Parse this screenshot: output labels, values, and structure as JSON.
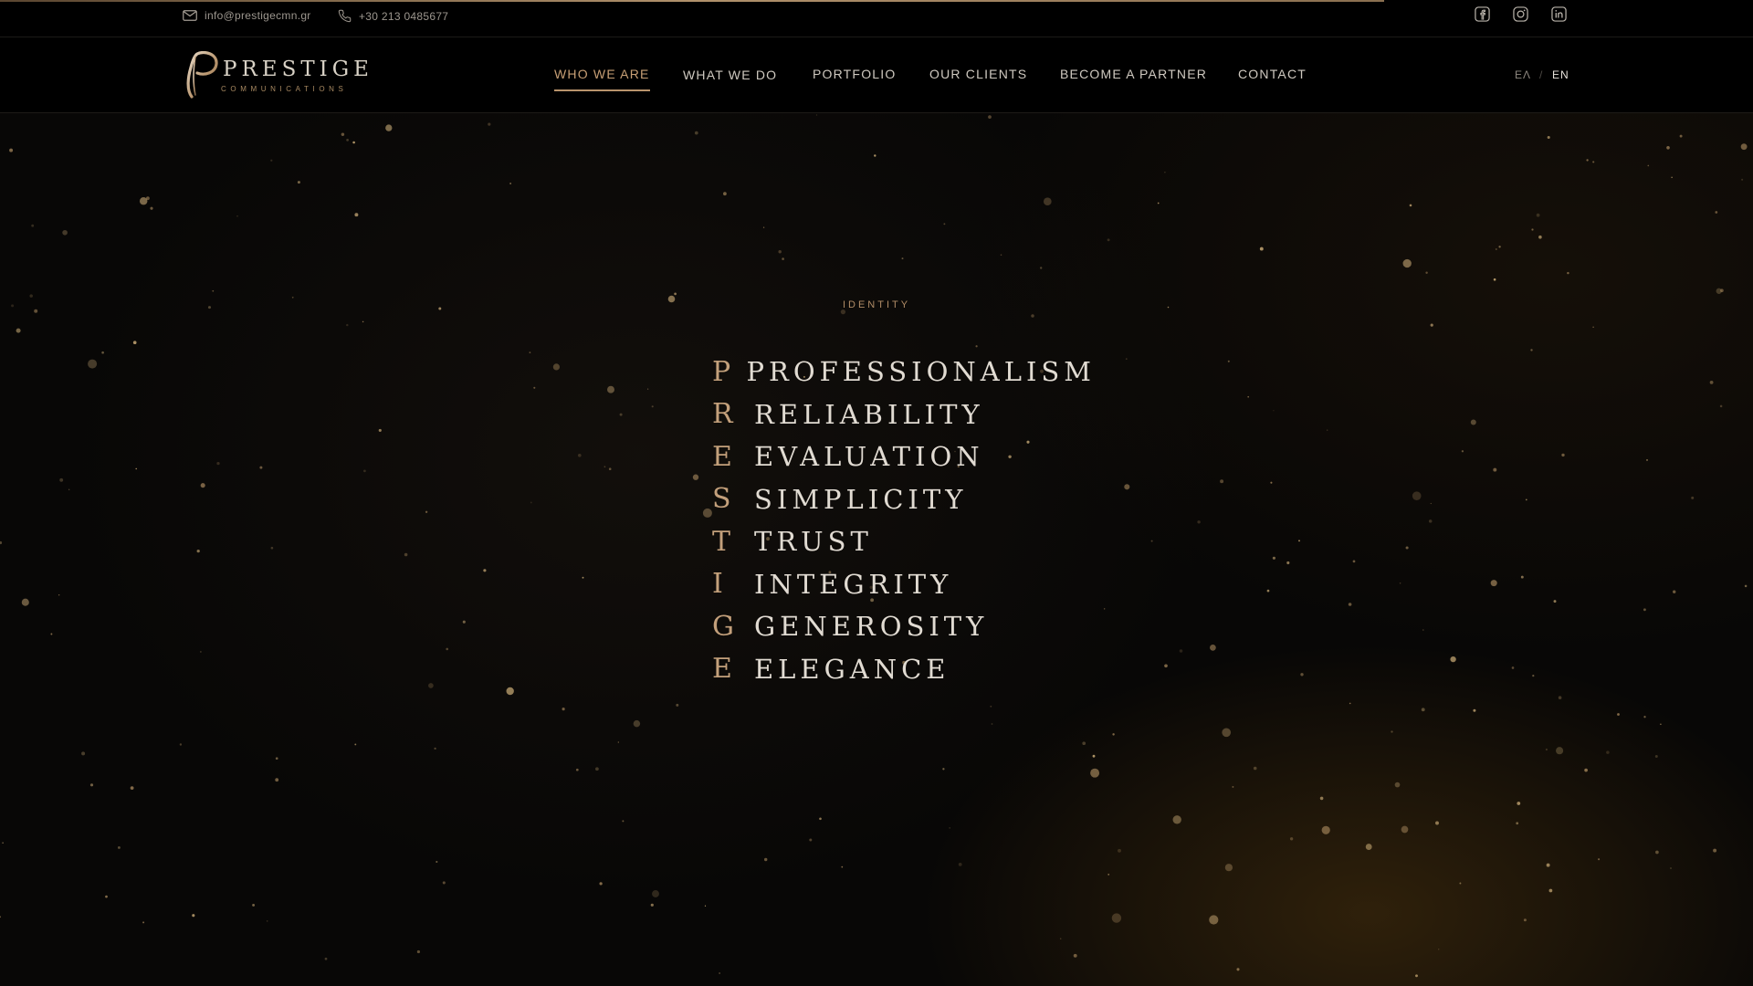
{
  "topbar": {
    "email": "info@prestigecmn.gr",
    "phone": "+30 213 0485677",
    "social": [
      "facebook-icon",
      "instagram-icon",
      "linkedin-icon"
    ]
  },
  "logo": {
    "wordmark": "PRESTIGE",
    "tagline": "COMMUNICATIONS"
  },
  "nav": {
    "items": [
      {
        "label": "WHO WE ARE",
        "active": true
      },
      {
        "label": "WHAT WE DO",
        "active": false
      },
      {
        "label": "PORTFOLIO",
        "active": false
      },
      {
        "label": "OUR CLIENTS",
        "active": false
      },
      {
        "label": "BECOME A PARTNER",
        "active": false
      },
      {
        "label": "CONTACT",
        "active": false
      }
    ]
  },
  "lang": {
    "greek": "ΕΛ",
    "separator": "/",
    "english": "EN",
    "selected": "EN"
  },
  "identity": {
    "eyebrow": "IDENTITY",
    "rows": [
      {
        "initial": "P",
        "word": "PROFESSIONALISM"
      },
      {
        "initial": "R",
        "word": "RELIABILITY"
      },
      {
        "initial": "E",
        "word": "EVALUATION"
      },
      {
        "initial": "S",
        "word": "SIMPLICITY"
      },
      {
        "initial": "T",
        "word": "TRUST"
      },
      {
        "initial": "I",
        "word": "INTEGRITY"
      },
      {
        "initial": "G",
        "word": "GENEROSITY"
      },
      {
        "initial": "E",
        "word": "ELEGANCE"
      }
    ]
  },
  "colors": {
    "accent_gold": "#c3a07b",
    "nav_active": "#c79f75",
    "background": "#080706"
  }
}
